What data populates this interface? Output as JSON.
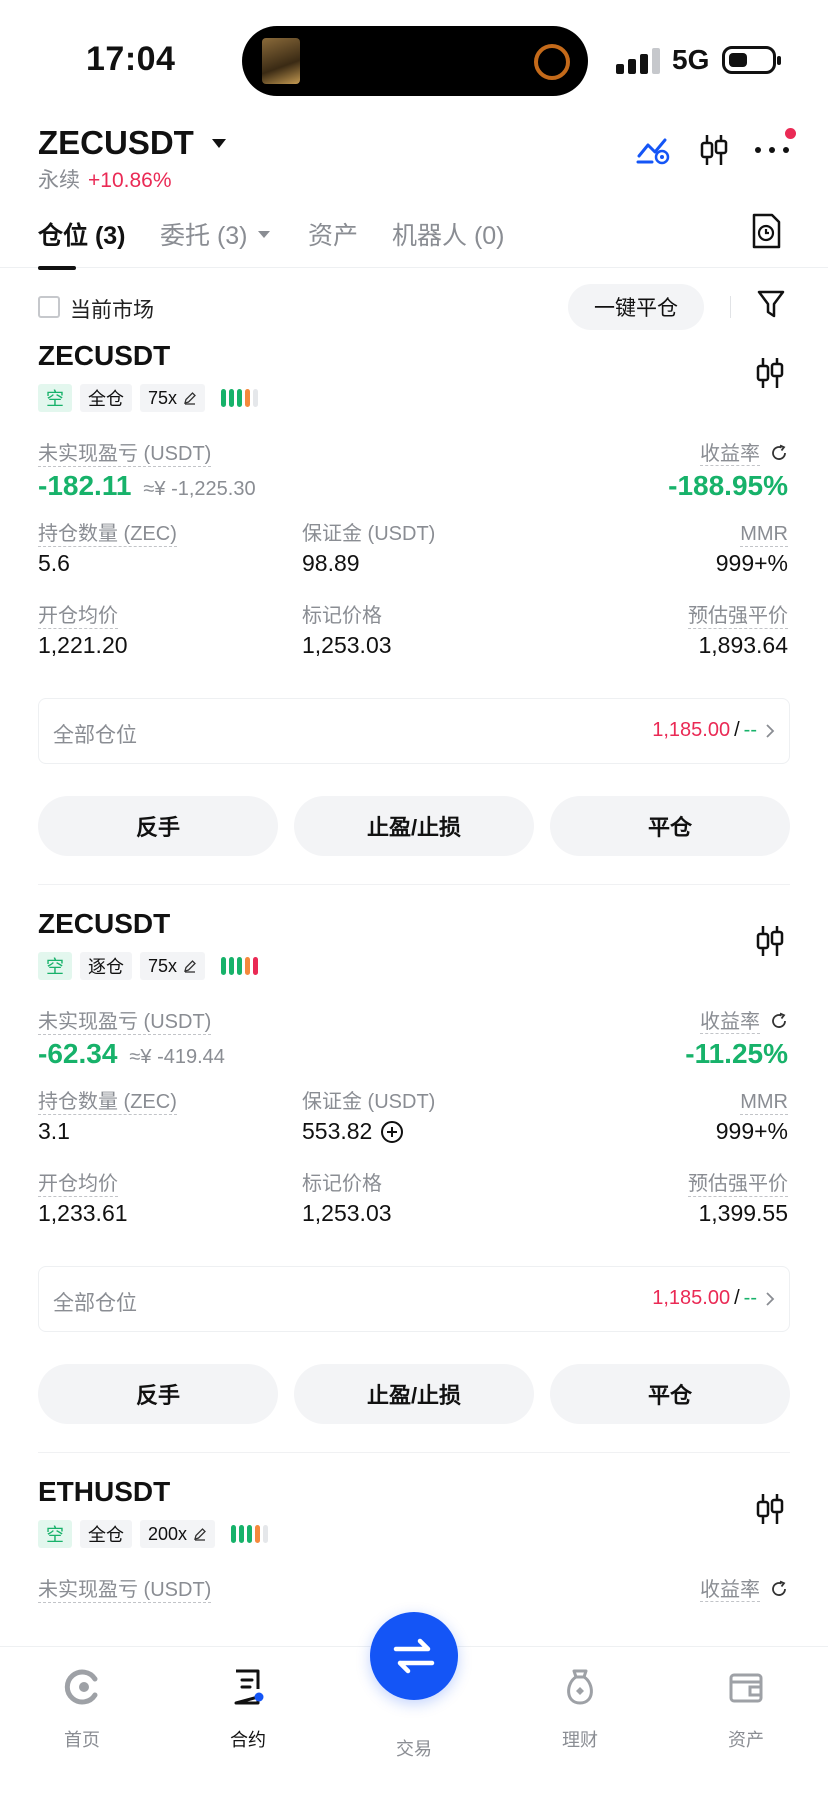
{
  "status_bar": {
    "time": "17:04",
    "network": "5G"
  },
  "header": {
    "pair": "ZECUSDT",
    "contract_type": "永续",
    "change": "+10.86%",
    "icons": [
      "trend-alert-icon",
      "candlestick-icon",
      "more-icon"
    ]
  },
  "tabs": [
    {
      "label": "仓位 (3)",
      "active": true
    },
    {
      "label": "委托 (3)",
      "active": false
    },
    {
      "label": "资产",
      "active": false
    },
    {
      "label": "机器人 (0)",
      "active": false
    }
  ],
  "filter": {
    "current_market_label": "当前市场",
    "close_all_label": "一键平仓"
  },
  "labels": {
    "unrealized_pnl": "未实现盈亏 (USDT)",
    "roi": "收益率",
    "margin": "保证金 (USDT)",
    "mmr": "MMR",
    "entry_price": "开仓均价",
    "mark_price": "标记价格",
    "liq_price": "预估强平价",
    "all_positions": "全部仓位",
    "reverse": "反手",
    "tp_sl": "止盈/止损",
    "close": "平仓"
  },
  "positions": [
    {
      "symbol": "ZECUSDT",
      "side": "空",
      "margin_mode": "全仓",
      "leverage": "75x",
      "risk_bars": [
        "#17b26a",
        "#17b26a",
        "#17b26a",
        "#f5893c",
        "#e5e7ea"
      ],
      "pnl": "-182.11",
      "pnl_cny": "≈¥ -1,225.30",
      "roi": "-188.95%",
      "qty_label": "持仓数量 (ZEC)",
      "qty": "5.6",
      "margin": "98.89",
      "mmr": "999+%",
      "entry": "1,221.20",
      "mark": "1,253.03",
      "liq": "1,893.64",
      "tpsl_price": "1,185.00",
      "tpsl_sl": "--"
    },
    {
      "symbol": "ZECUSDT",
      "side": "空",
      "margin_mode": "逐仓",
      "leverage": "75x",
      "risk_bars": [
        "#17b26a",
        "#17b26a",
        "#17b26a",
        "#f5893c",
        "#ea2a55"
      ],
      "pnl": "-62.34",
      "pnl_cny": "≈¥ -419.44",
      "roi": "-11.25%",
      "qty_label": "持仓数量 (ZEC)",
      "qty": "3.1",
      "margin": "553.82",
      "mmr": "999+%",
      "entry": "1,233.61",
      "mark": "1,253.03",
      "liq": "1,399.55",
      "tpsl_price": "1,185.00",
      "tpsl_sl": "--"
    },
    {
      "symbol": "ETHUSDT",
      "side": "空",
      "margin_mode": "全仓",
      "leverage": "200x",
      "risk_bars": [
        "#17b26a",
        "#17b26a",
        "#17b26a",
        "#f5893c",
        "#e5e7ea"
      ]
    }
  ],
  "bottom_nav": [
    {
      "label": "首页",
      "icon": "home-icon"
    },
    {
      "label": "合约",
      "icon": "futures-icon",
      "active": true
    },
    {
      "label": "交易",
      "icon": "swap-icon"
    },
    {
      "label": "理财",
      "icon": "earn-icon"
    },
    {
      "label": "资产",
      "icon": "wallet-icon"
    }
  ],
  "colors": {
    "green": "#17b26a",
    "red": "#ea2a55",
    "orange": "#f5893c",
    "accent": "#1455f6"
  }
}
